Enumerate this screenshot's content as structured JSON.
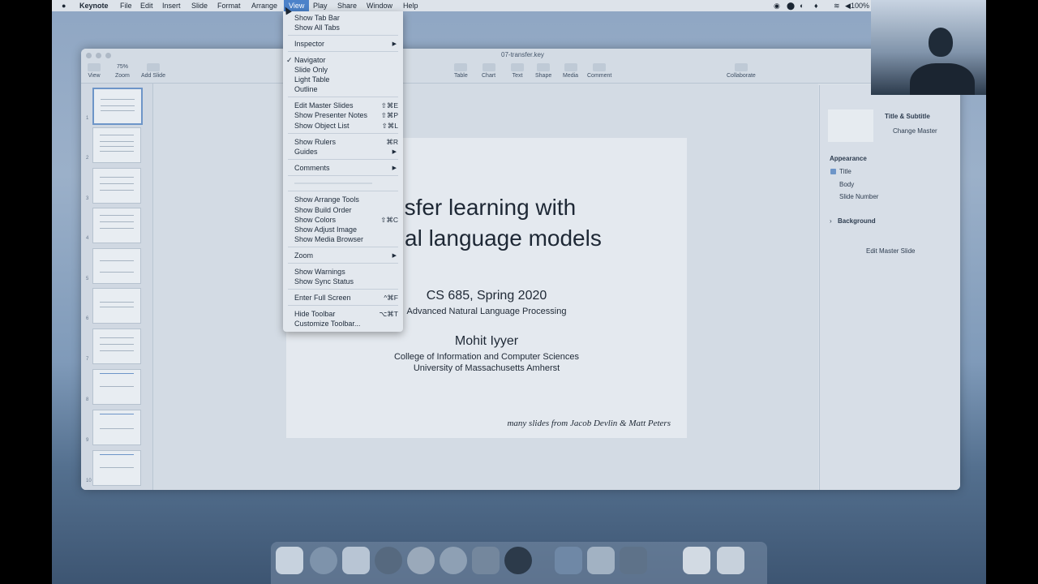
{
  "menubar": {
    "app": "Keynote",
    "items": [
      "File",
      "Edit",
      "Insert",
      "Slide",
      "Format",
      "Arrange",
      "View",
      "Play",
      "Share",
      "Window",
      "Help"
    ],
    "battery": "100%"
  },
  "window": {
    "title": "07-transfer.key",
    "toolbar_left": [
      "View",
      "Zoom",
      "Add Slide"
    ],
    "zoom_value": "75%",
    "toolbar_center": [
      "Table",
      "Chart",
      "Text",
      "Shape",
      "Media",
      "Comment"
    ],
    "collaborate": "Collaborate"
  },
  "view_menu": {
    "items": [
      {
        "label": "Show Tab Bar"
      },
      {
        "label": "Show All Tabs"
      },
      {
        "label": "Inspector",
        "submenu": true
      },
      {
        "label": "Navigator",
        "checked": true
      },
      {
        "label": "Slide Only"
      },
      {
        "label": "Light Table"
      },
      {
        "label": "Outline"
      },
      {
        "label": "Edit Master Slides",
        "shortcut": "⇧⌘E"
      },
      {
        "label": "Show Presenter Notes",
        "shortcut": "⇧⌘P"
      },
      {
        "label": "Show Object List",
        "shortcut": "⇧⌘L"
      },
      {
        "label": "Show Rulers",
        "shortcut": "⌘R"
      },
      {
        "label": "Guides",
        "submenu": true
      },
      {
        "label": "Comments",
        "submenu": true
      },
      {
        "label": "Show Arrange Tools"
      },
      {
        "label": "Show Build Order"
      },
      {
        "label": "Show Colors",
        "shortcut": "⇧⌘C"
      },
      {
        "label": "Show Adjust Image"
      },
      {
        "label": "Show Media Browser"
      },
      {
        "label": "Zoom",
        "submenu": true
      },
      {
        "label": "Show Warnings"
      },
      {
        "label": "Show Sync Status"
      },
      {
        "label": "Enter Full Screen",
        "shortcut": "^⌘F"
      },
      {
        "label": "Hide Toolbar",
        "shortcut": "⌥⌘T"
      },
      {
        "label": "Customize Toolbar..."
      }
    ]
  },
  "slide": {
    "title_line1": "nsfer learning with",
    "title_line2": "al language models",
    "course": "CS 685, Spring 2020",
    "course_sub": "Advanced Natural Language Processing",
    "author": "Mohit Iyyer",
    "affil1": "College of Information and Computer Sciences",
    "affil2": "University of Massachusetts Amherst",
    "note": "many slides from Jacob Devlin & Matt Peters"
  },
  "inspector": {
    "layout": "Title & Subtitle",
    "change_master": "Change Master",
    "appearance": "Appearance",
    "options": [
      "Title",
      "Body",
      "Slide Number"
    ],
    "background": "Background",
    "edit_master": "Edit Master Slide"
  },
  "navigator": {
    "slide_numbers": [
      "1",
      "2",
      "3",
      "4",
      "5",
      "6",
      "7",
      "8",
      "9",
      "10"
    ]
  }
}
